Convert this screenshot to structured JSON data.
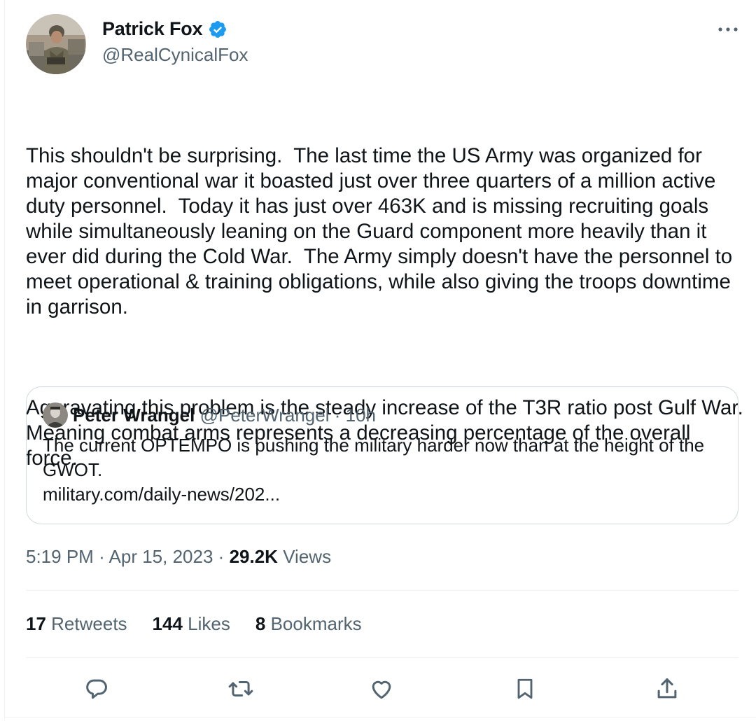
{
  "author": {
    "display_name": "Patrick Fox",
    "handle": "@RealCynicalFox",
    "verified": true,
    "avatar_icon": "profile-photo-soldier"
  },
  "tweet": {
    "paragraphs": [
      "This shouldn't be surprising.  The last time the US Army was organized for major conventional war it boasted just over three quarters of a million active duty personnel.  Today it has just over 463K and is missing recruiting goals while simultaneously leaning on the Guard component more heavily than it ever did during the Cold War.  The Army simply doesn't have the personnel to meet operational & training obligations, while also giving the troops downtime in garrison.",
      "Aggravating this problem is the steady increase of the T3R ratio post Gulf War.  Meaning combat arms represents a decreasing percentage of the overall force."
    ]
  },
  "quote": {
    "display_name": "Peter Wrangel",
    "handle": "@PeterWrangel",
    "separator": "·",
    "time": "10h",
    "text": "The current OPTEMPO is pushing the military harder now than at the height of the GWOT.",
    "link": "military.com/daily-news/202..."
  },
  "meta": {
    "time": "5:19 PM",
    "separator": "·",
    "date": "Apr 15, 2023",
    "views_count": "29.2K",
    "views_label": "Views"
  },
  "stats": [
    {
      "count": "17",
      "label": "Retweets"
    },
    {
      "count": "144",
      "label": "Likes"
    },
    {
      "count": "8",
      "label": "Bookmarks"
    }
  ],
  "icons": {
    "more": "more-horizontal-icon",
    "reply": "reply-icon",
    "retweet": "retweet-icon",
    "like": "heart-icon",
    "bookmark": "bookmark-icon",
    "share": "share-icon"
  },
  "colors": {
    "text": "#0f1419",
    "secondary": "#536471",
    "verified": "#1d9bf0",
    "border": "#cfd9de",
    "divider": "#eff3f4"
  }
}
